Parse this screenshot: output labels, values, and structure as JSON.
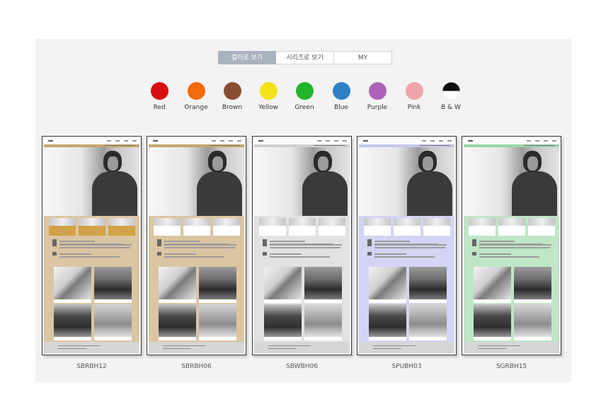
{
  "tabs": [
    {
      "label": "컬러로 보기",
      "active": true
    },
    {
      "label": "시리즈로 보기",
      "active": false
    },
    {
      "label": "MY",
      "active": false
    }
  ],
  "colors": [
    {
      "label": "Red",
      "hex": "#d90f0f"
    },
    {
      "label": "Orange",
      "hex": "#f26a0a"
    },
    {
      "label": "Brown",
      "hex": "#8a4f33"
    },
    {
      "label": "Yellow",
      "hex": "#f3e11a"
    },
    {
      "label": "Green",
      "hex": "#22b429"
    },
    {
      "label": "Blue",
      "hex": "#2f80c4"
    },
    {
      "label": "Purple",
      "hex": "#ad62b8"
    },
    {
      "label": "Pink",
      "hex": "#eea4a8"
    },
    {
      "label": "B & W",
      "hex": "#111111"
    }
  ],
  "templates": [
    {
      "name": "SBRBH12",
      "bg": "#dcc5a2",
      "bar": "#c8a46d",
      "caption": "#d1a247"
    },
    {
      "name": "SBRBH06",
      "bg": "#dcc5a2",
      "bar": "#c8a46d",
      "caption": "#ffffff"
    },
    {
      "name": "SBWBH06",
      "bg": "#e2e2e2",
      "bar": "#cfcfcf",
      "caption": "#ffffff"
    },
    {
      "name": "SPUBH03",
      "bg": "#d4d4f4",
      "bar": "#c5c5ee",
      "caption": "#ffffff"
    },
    {
      "name": "SGRBH15",
      "bg": "#bfe6c6",
      "bar": "#9cd4a8",
      "caption": "#ffffff"
    }
  ]
}
